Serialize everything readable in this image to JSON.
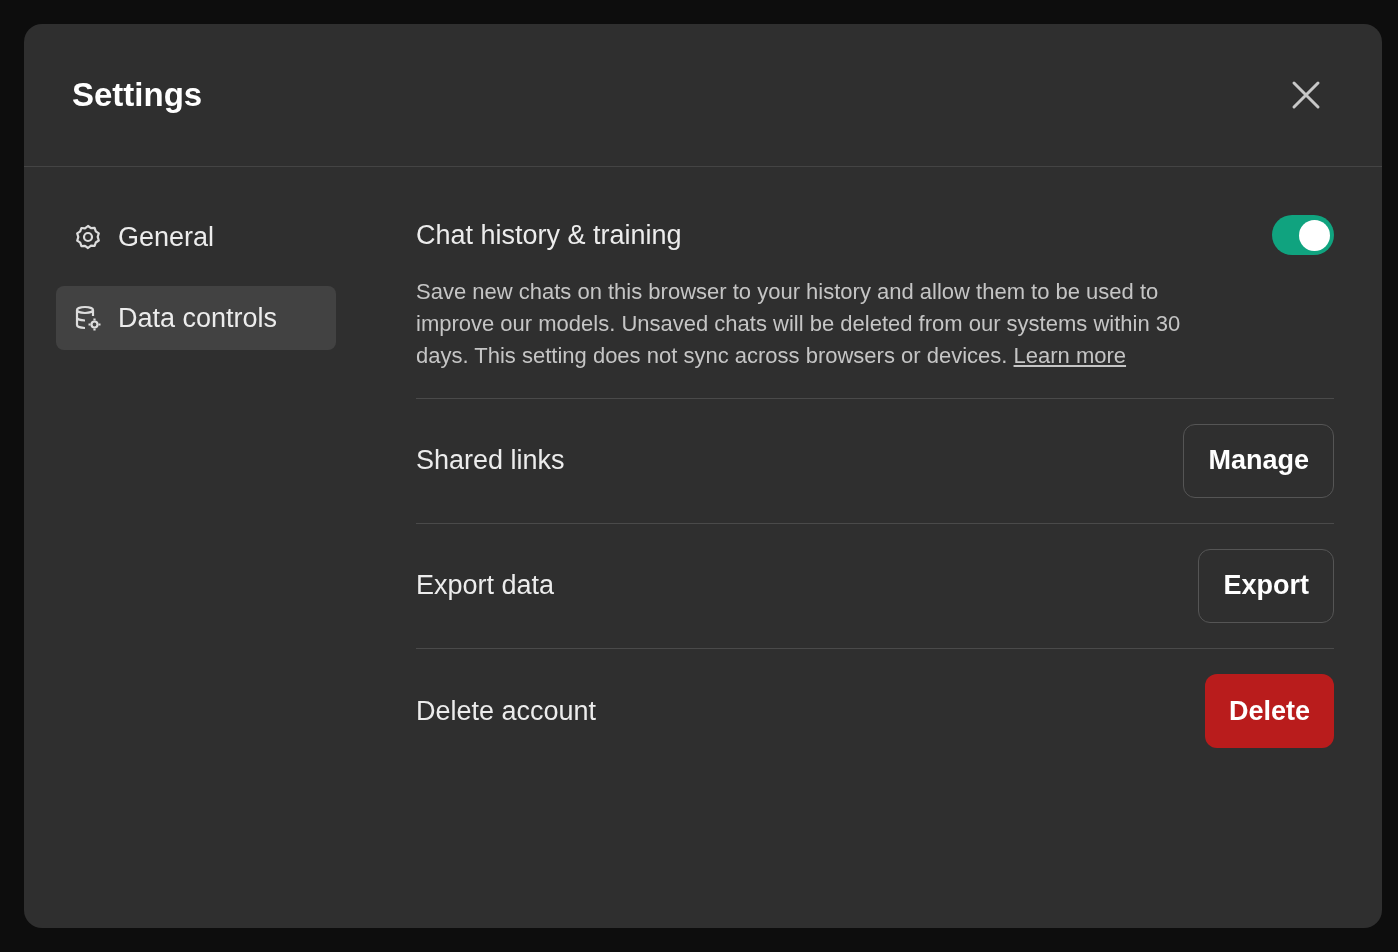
{
  "dialog": {
    "title": "Settings"
  },
  "sidebar": {
    "items": [
      {
        "label": "General",
        "kind": "gear",
        "selected": false
      },
      {
        "label": "Data controls",
        "kind": "database",
        "selected": true
      }
    ]
  },
  "settings": [
    {
      "kind": "toggle",
      "label": "Chat history & training",
      "on": true,
      "description": "Save new chats on this browser to your history and allow them to be used to improve our models. Unsaved chats will be deleted from our systems within 30 days. This setting does not sync across browsers or devices.",
      "link": "Learn more"
    },
    {
      "kind": "button",
      "label": "Shared links",
      "button": "Manage",
      "danger": false
    },
    {
      "kind": "button",
      "label": "Export data",
      "button": "Export",
      "danger": false
    },
    {
      "kind": "button",
      "label": "Delete account",
      "button": "Delete",
      "danger": true
    }
  ]
}
